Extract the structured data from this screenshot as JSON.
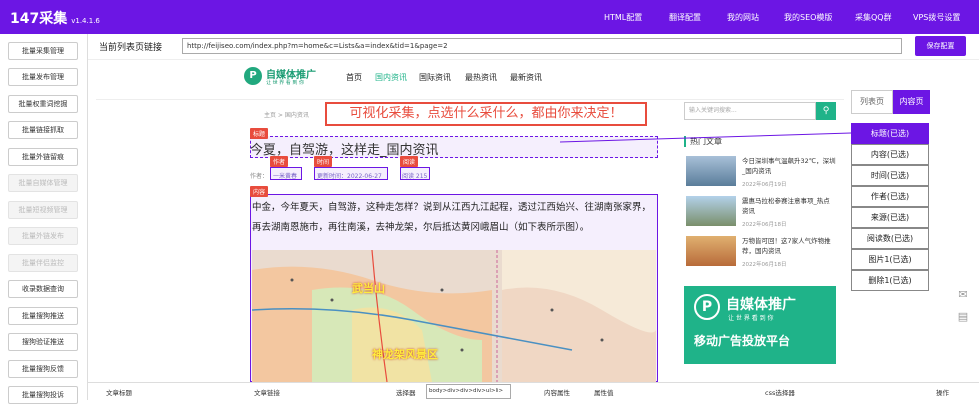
{
  "app": {
    "title": "147采集",
    "version": "v1.4.1.6"
  },
  "topnav": [
    "HTML配置",
    "翻译配置",
    "我的网站",
    "我的SEO模版",
    "采集QQ群",
    "VPS拨号设置"
  ],
  "sidebar": {
    "items": [
      {
        "label": "批量采集管理",
        "enabled": true
      },
      {
        "label": "批量发布管理",
        "enabled": true
      },
      {
        "label": "批量权重词挖掘",
        "enabled": true
      },
      {
        "label": "批量链接抓取",
        "enabled": true
      },
      {
        "label": "批量外链留痕",
        "enabled": true
      },
      {
        "label": "批量自媒体管理",
        "enabled": false
      },
      {
        "label": "批量短视频管理",
        "enabled": false
      },
      {
        "label": "批量外链发布",
        "enabled": false
      },
      {
        "label": "批量伴侣监控",
        "enabled": false
      },
      {
        "label": "收录数据查询",
        "enabled": true
      },
      {
        "label": "批量搜狗推送",
        "enabled": true
      },
      {
        "label": "搜狗验证推送",
        "enabled": true
      },
      {
        "label": "批量搜狗反馈",
        "enabled": true
      },
      {
        "label": "批量搜狗投诉",
        "enabled": true
      }
    ]
  },
  "url_bar": {
    "label": "当前列表页链接",
    "value": "http://feijiseo.com/index.php?m=home&c=Lists&a=index&tid=1&page=2",
    "save_label": "保存配置"
  },
  "site": {
    "logo_mark": "P",
    "logo_text": "自媒体推广",
    "logo_sub": "让 世 界 看 到 你",
    "nav": [
      "首页",
      "国内资讯",
      "国际资讯",
      "最热资讯",
      "最新资讯"
    ],
    "breadcrumb": "主页 > 国内资讯",
    "banner": "可视化采集，点选什么采什么，都由你来决定！",
    "article_title": "今夏，自驾游，这样走_国内资讯",
    "meta_prefix": "作者：",
    "author": "一米黄春",
    "time": "更新时间：2022-06-27",
    "views": "阅读 215",
    "body": "中金，今年夏天，自驾游，这种走怎样？说到从江西九江起程，透过江西始兴、往湖南张家界，再去湖南恩施市，再往南溪，去神龙架，尔后抵达黄冈峨眉山（如下表所示图）。",
    "map_labels": [
      "武当山",
      "神龙架风景区"
    ],
    "search_placeholder": "输入关键词搜索...",
    "hot_title": "热门文章",
    "news": [
      {
        "title": "今日深圳事气温飙升32℃，深圳_国内资讯",
        "date": "2022年06月19日"
      },
      {
        "title": "震惠马拉松参赛注意事项_热点资讯",
        "date": "2022年06月18日"
      },
      {
        "title": "万物皆可回！这7家人气炸物推荐，国内资讯",
        "date": "2022年06月18日"
      }
    ],
    "ad_text": "自媒体推广",
    "ad_sub": "让 世 界 看 到 你",
    "ad_slogan": "移动广告投放平台"
  },
  "tags": {
    "title": "标题",
    "author": "作者",
    "time": "时间",
    "views": "阅读",
    "content": "内容"
  },
  "right_panel": {
    "tabs": [
      {
        "label": "列表页",
        "active": false
      },
      {
        "label": "内容页",
        "active": true
      }
    ],
    "fields": [
      {
        "label": "标题(已选)",
        "active": true
      },
      {
        "label": "内容(已选)",
        "active": false
      },
      {
        "label": "时间(已选)",
        "active": false
      },
      {
        "label": "作者(已选)",
        "active": false
      },
      {
        "label": "来源(已选)",
        "active": false
      },
      {
        "label": "阅读数(已选)",
        "active": false
      },
      {
        "label": "图片1(已选)",
        "active": false
      },
      {
        "label": "删除1(已选)",
        "active": false
      }
    ]
  },
  "table": {
    "headers": [
      "文章标题",
      "文章链接",
      "选择器",
      "内容属性",
      "属性值",
      "css选择器",
      "操作"
    ],
    "selector_value": "body>div>div>div>ul>li>"
  },
  "colors": {
    "accent": "#6c16e4",
    "green": "#1fb389",
    "red": "#e84c3d"
  }
}
